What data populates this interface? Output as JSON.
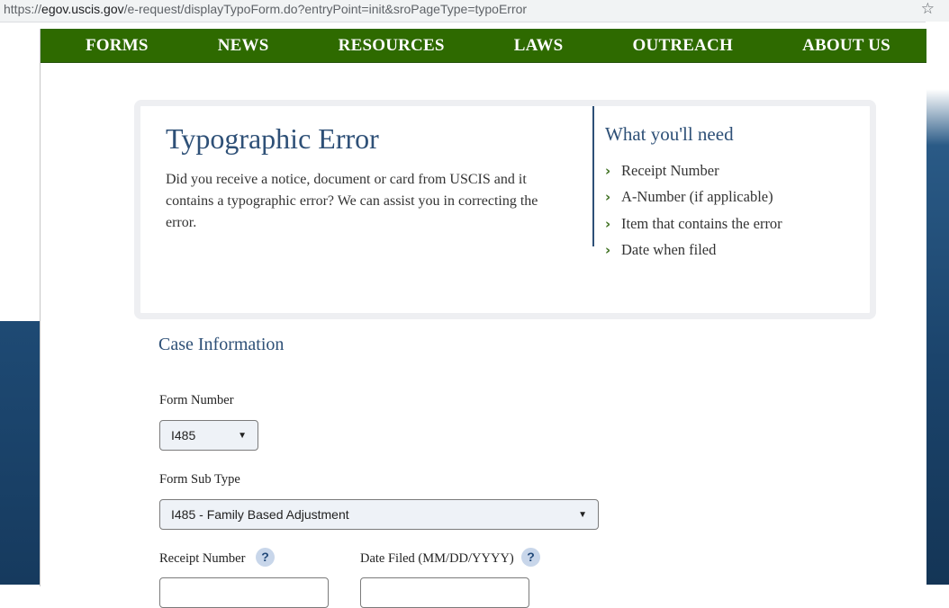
{
  "browser": {
    "url_prefix": "https://",
    "url_host": "egov.uscis.gov",
    "url_path": "/e-request/displayTypoForm.do?entryPoint=init&sroPageType=typoError",
    "bookmark_icon": "star-icon"
  },
  "nav": {
    "items": [
      "FORMS",
      "NEWS",
      "RESOURCES",
      "LAWS",
      "OUTREACH",
      "ABOUT US"
    ]
  },
  "intro": {
    "title": "Typographic Error",
    "description": "Did you receive a notice, document or card from USCIS and it contains a typographic error? We can assist you in correcting the error.",
    "need_title": "What you'll need",
    "need_items": [
      "Receipt Number",
      "A-Number (if applicable)",
      "Item that contains the error",
      "Date when filed"
    ]
  },
  "form": {
    "section_title": "Case Information",
    "form_number_label": "Form Number",
    "form_number_value": "I485",
    "form_sub_type_label": "Form Sub Type",
    "form_sub_type_value": "I485 - Family Based Adjustment",
    "receipt_number_label": "Receipt Number",
    "date_filed_label": "Date Filed (MM/DD/YYYY)",
    "help_glyph": "?"
  },
  "colors": {
    "nav_bg": "#2e6a00",
    "heading": "#2e5077",
    "chevron": "#3d6f1f"
  }
}
